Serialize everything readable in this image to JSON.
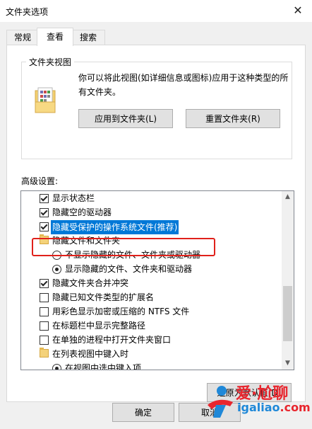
{
  "window": {
    "title": "文件夹选项",
    "close_glyph": "✕"
  },
  "tabs": [
    {
      "label": "常规",
      "active": false
    },
    {
      "label": "查看",
      "active": true
    },
    {
      "label": "搜索",
      "active": false
    }
  ],
  "folder_view": {
    "legend": "文件夹视图",
    "description": "你可以将此视图(如详细信息或图标)应用于这种类型的所有文件夹。",
    "apply_button": "应用到文件夹(L)",
    "reset_button": "重置文件夹(R)"
  },
  "advanced": {
    "label": "高级设置:",
    "items": [
      {
        "kind": "checkbox",
        "checked": true,
        "level": 1,
        "label": "显示状态栏"
      },
      {
        "kind": "checkbox",
        "checked": true,
        "level": 1,
        "label": "隐藏空的驱动器"
      },
      {
        "kind": "checkbox",
        "checked": true,
        "level": 1,
        "label": "隐藏受保护的操作系统文件(推荐)",
        "selected": true
      },
      {
        "kind": "folder",
        "level": 1,
        "label": "隐藏文件和文件夹"
      },
      {
        "kind": "radio",
        "checked": false,
        "level": 2,
        "label": "不显示隐藏的文件、文件夹或驱动器"
      },
      {
        "kind": "radio",
        "checked": true,
        "level": 2,
        "label": "显示隐藏的文件、文件夹和驱动器",
        "highlighted": true
      },
      {
        "kind": "checkbox",
        "checked": true,
        "level": 1,
        "label": "隐藏文件夹合并冲突"
      },
      {
        "kind": "checkbox",
        "checked": false,
        "level": 1,
        "label": "隐藏已知文件类型的扩展名"
      },
      {
        "kind": "checkbox",
        "checked": false,
        "level": 1,
        "label": "用彩色显示加密或压缩的 NTFS 文件"
      },
      {
        "kind": "checkbox",
        "checked": false,
        "level": 1,
        "label": "在标题栏中显示完整路径"
      },
      {
        "kind": "checkbox",
        "checked": false,
        "level": 1,
        "label": "在单独的进程中打开文件夹窗口"
      },
      {
        "kind": "folder",
        "level": 1,
        "label": "在列表视图中键入时"
      },
      {
        "kind": "radio",
        "checked": true,
        "level": 2,
        "label": "在视图中选中键入项"
      }
    ],
    "restore_button": "还原为默认值(D)"
  },
  "footer": {
    "ok": "确定",
    "cancel": "取消"
  },
  "watermark": {
    "text_cn": "爱·尬聊",
    "url_part1": "igaliao",
    "url_part2": ".com"
  },
  "colors": {
    "selection": "#0078d7",
    "highlight_box": "#e0211b"
  }
}
